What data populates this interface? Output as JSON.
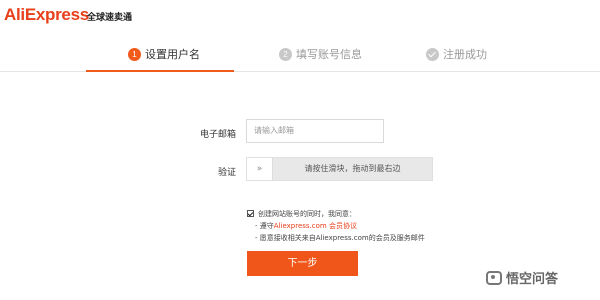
{
  "header": {
    "logo_ali": "Ali",
    "logo_express": "Express",
    "slogan": "全球速卖通"
  },
  "steps": [
    {
      "num": "1",
      "label": "设置用户名",
      "state": "active"
    },
    {
      "num": "2",
      "label": "填写账号信息",
      "state": "pending"
    },
    {
      "num": "",
      "label": "注册成功",
      "state": "pending"
    }
  ],
  "form": {
    "email_label": "电子邮箱",
    "email_placeholder": "请输入邮箱",
    "verify_label": "验证",
    "slider_handle": "»",
    "slider_text": "请按住滑块，拖动到最右边"
  },
  "agreement": {
    "line1": "创建网站账号的同时，我同意：",
    "line2_prefix": "- 遵守",
    "line2_link1": "Aliexpress.com",
    "line2_link2": "会员协议",
    "line3": "- 愿意接收相关来自Aliexpress.com的会员及服务邮件",
    "checked": true
  },
  "next_button": "下一步",
  "watermark": "悟空问答",
  "colors": {
    "accent": "#f0561a",
    "brand": "#e8401b"
  }
}
